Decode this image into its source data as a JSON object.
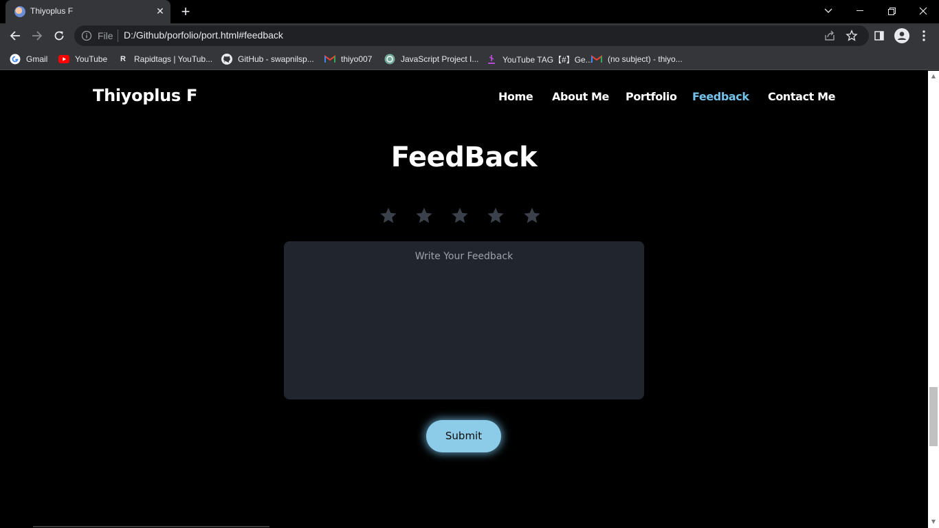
{
  "browser": {
    "tab_title": "Thiyoplus F",
    "omnibox": {
      "scheme_label": "File",
      "url": "D:/Github/porfolio/port.html#feedback"
    },
    "bookmarks": [
      {
        "label": "Gmail",
        "icon": "google-icon"
      },
      {
        "label": "YouTube",
        "icon": "youtube-icon"
      },
      {
        "label": "Rapidtags | YouTub...",
        "icon": "rapidtags-icon"
      },
      {
        "label": "GitHub - swapnilsp...",
        "icon": "github-icon"
      },
      {
        "label": "thiyo007",
        "icon": "gmail-icon"
      },
      {
        "label": "JavaScript Project I...",
        "icon": "openai-icon"
      },
      {
        "label": "YouTube TAG【#】Ge...",
        "icon": "tag-icon"
      },
      {
        "label": "(no subject) - thiyo...",
        "icon": "gmail-icon"
      }
    ]
  },
  "page": {
    "logo": "Thiyoplus F",
    "nav": [
      {
        "label": "Home",
        "active": false
      },
      {
        "label": "About Me",
        "active": false
      },
      {
        "label": "Portfolio",
        "active": false
      },
      {
        "label": "Feedback",
        "active": true
      },
      {
        "label": "Contact Me",
        "active": false
      }
    ],
    "section_title": "FeedBack",
    "rating": {
      "value": 0,
      "max": 5
    },
    "feedback_placeholder": "Write Your Feedback",
    "submit_label": "Submit"
  },
  "colors": {
    "accent": "#74c2ea",
    "button": "#8ccce9",
    "star": "#3b414b",
    "textarea_bg": "#21252d"
  }
}
